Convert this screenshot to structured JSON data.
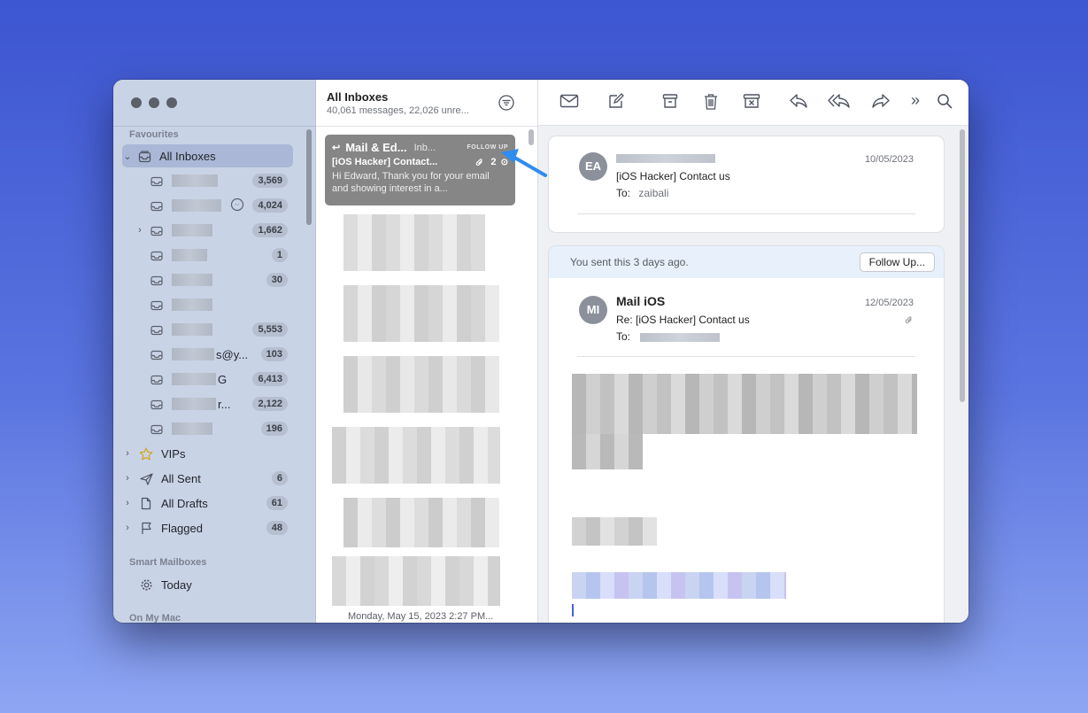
{
  "sidebar": {
    "favourites_label": "Favourites",
    "all_inboxes": "All Inboxes",
    "accounts": [
      {
        "prefix": "",
        "suffix": "",
        "count": "3,569"
      },
      {
        "prefix": "",
        "suffix": "",
        "count": "4,024"
      },
      {
        "prefix": "",
        "suffix": "",
        "count": "1,662"
      },
      {
        "prefix": "",
        "suffix": "",
        "count": "1"
      },
      {
        "prefix": "",
        "suffix": "",
        "count": "30"
      },
      {
        "prefix": "",
        "suffix": "",
        "count": ""
      },
      {
        "prefix": "",
        "suffix": "",
        "count": "5,553"
      },
      {
        "prefix": "",
        "suffix": "s@y...",
        "count": "103"
      },
      {
        "prefix": "",
        "suffix": "G",
        "count": "6,413"
      },
      {
        "prefix": "",
        "suffix": "r...",
        "count": "2,122"
      },
      {
        "prefix": "",
        "suffix": "",
        "count": "196"
      }
    ],
    "vips": "VIPs",
    "all_sent": "All Sent",
    "all_sent_count": "6",
    "all_drafts": "All Drafts",
    "all_drafts_count": "61",
    "flagged": "Flagged",
    "flagged_count": "48",
    "smart_mailboxes_label": "Smart Mailboxes",
    "today": "Today",
    "on_my_mac_label": "On My Mac"
  },
  "list": {
    "title": "All Inboxes",
    "subtitle": "40,061 messages, 22,026 unre...",
    "selected": {
      "from": "Mail & Ed...",
      "mailbox": "Inb...",
      "flag": "FOLLOW UP",
      "subject": "[iOS Hacker] Contact...",
      "attachments": "2",
      "preview": "Hi Edward, Thank you for your email and showing interest in a..."
    },
    "footer_date": "Monday, May 15, 2023 2:27 PM..."
  },
  "reader": {
    "msg1": {
      "initials": "EA",
      "date": "10/05/2023",
      "subject": "[iOS Hacker] Contact us",
      "to_label": "To:",
      "to": "zaibali"
    },
    "sent_notice": "You sent this 3 days ago.",
    "follow_up_button": "Follow Up...",
    "msg2": {
      "initials": "MI",
      "from": "Mail iOS",
      "date": "12/05/2023",
      "subject": "Re: [iOS Hacker] Contact us",
      "to_label": "To:"
    }
  },
  "colors": {
    "accent_arrow": "#2f8cf0",
    "sidebar_bg": "#c9d3e6",
    "selected_row": "#aab7d6",
    "selected_message": "#868686"
  }
}
